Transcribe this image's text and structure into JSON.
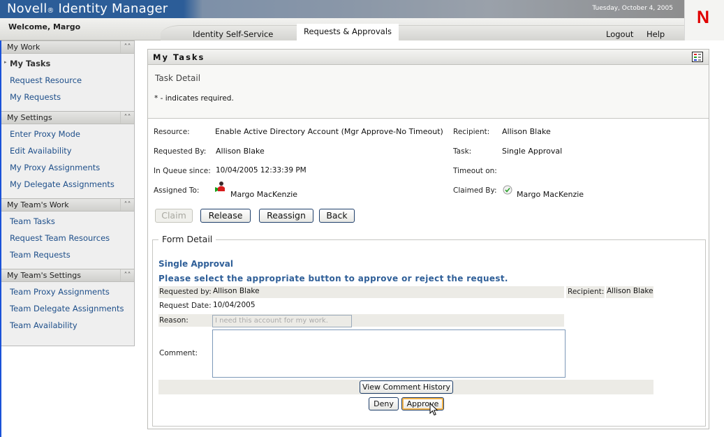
{
  "header": {
    "brand": "Novell",
    "brand_reg": "®",
    "brand_product": "Identity Manager",
    "date": "Tuesday, October 4, 2005",
    "welcome": "Welcome, Margo",
    "tabs": [
      {
        "label": "Identity Self-Service",
        "active": false
      },
      {
        "label": "Requests & Approvals",
        "active": true
      }
    ],
    "logout": "Logout",
    "help": "Help",
    "logo_letter": "N",
    "logo_color": "#e00000"
  },
  "sidebar": {
    "sections": [
      {
        "title": "My Work",
        "items": [
          {
            "label": "My Tasks",
            "selected": true
          },
          {
            "label": "Request Resource"
          },
          {
            "label": "My Requests"
          }
        ]
      },
      {
        "title": "My Settings",
        "items": [
          {
            "label": "Enter Proxy Mode"
          },
          {
            "label": "Edit Availability"
          },
          {
            "label": "My Proxy Assignments"
          },
          {
            "label": "My Delegate Assignments"
          }
        ]
      },
      {
        "title": "My Team's Work",
        "items": [
          {
            "label": "Team Tasks"
          },
          {
            "label": "Request Team Resources"
          },
          {
            "label": "Team Requests"
          }
        ]
      },
      {
        "title": "My Team's Settings",
        "items": [
          {
            "label": "Team Proxy Assignments"
          },
          {
            "label": "Team Delegate Assignments"
          },
          {
            "label": "Team Availability"
          }
        ]
      }
    ],
    "collapse_icon": "double-chevron-up-icon"
  },
  "panel": {
    "title": "My Tasks",
    "icon": "layout-grid-icon",
    "task_detail_title": "Task Detail",
    "required_note": "* - indicates required.",
    "fields": {
      "resource_label": "Resource:",
      "resource": "Enable Active Directory Account (Mgr Approve-No Timeout)",
      "requested_by_label": "Requested By:",
      "requested_by": "Allison Blake",
      "in_queue_label": "In Queue since:",
      "in_queue": "10/04/2005 12:33:39 PM",
      "assigned_to_label": "Assigned To:",
      "assigned_to": "Margo MacKenzie",
      "recipient_label": "Recipient:",
      "recipient": "Allison Blake",
      "task_label": "Task:",
      "task": "Single Approval",
      "timeout_label": "Timeout on:",
      "timeout": "",
      "claimed_by_label": "Claimed By:",
      "claimed_by": "Margo MacKenzie"
    },
    "buttons": {
      "claim": "Claim",
      "release": "Release",
      "reassign": "Reassign",
      "back": "Back"
    },
    "form": {
      "legend": "Form Detail",
      "title": "Single Approval",
      "instruction": "Please select the appropriate button to approve or reject the request.",
      "requested_by_label": "Requested by:",
      "requested_by": "Allison Blake",
      "recipient_label": "Recipient:",
      "recipient": "Allison Blake",
      "request_date_label": "Request Date:",
      "request_date": "10/04/2005",
      "reason_label": "Reason:",
      "reason": "I need this account for my work.",
      "comment_label": "Comment:",
      "comment": "",
      "view_history": "View Comment History",
      "deny": "Deny",
      "approve": "Approve"
    }
  }
}
